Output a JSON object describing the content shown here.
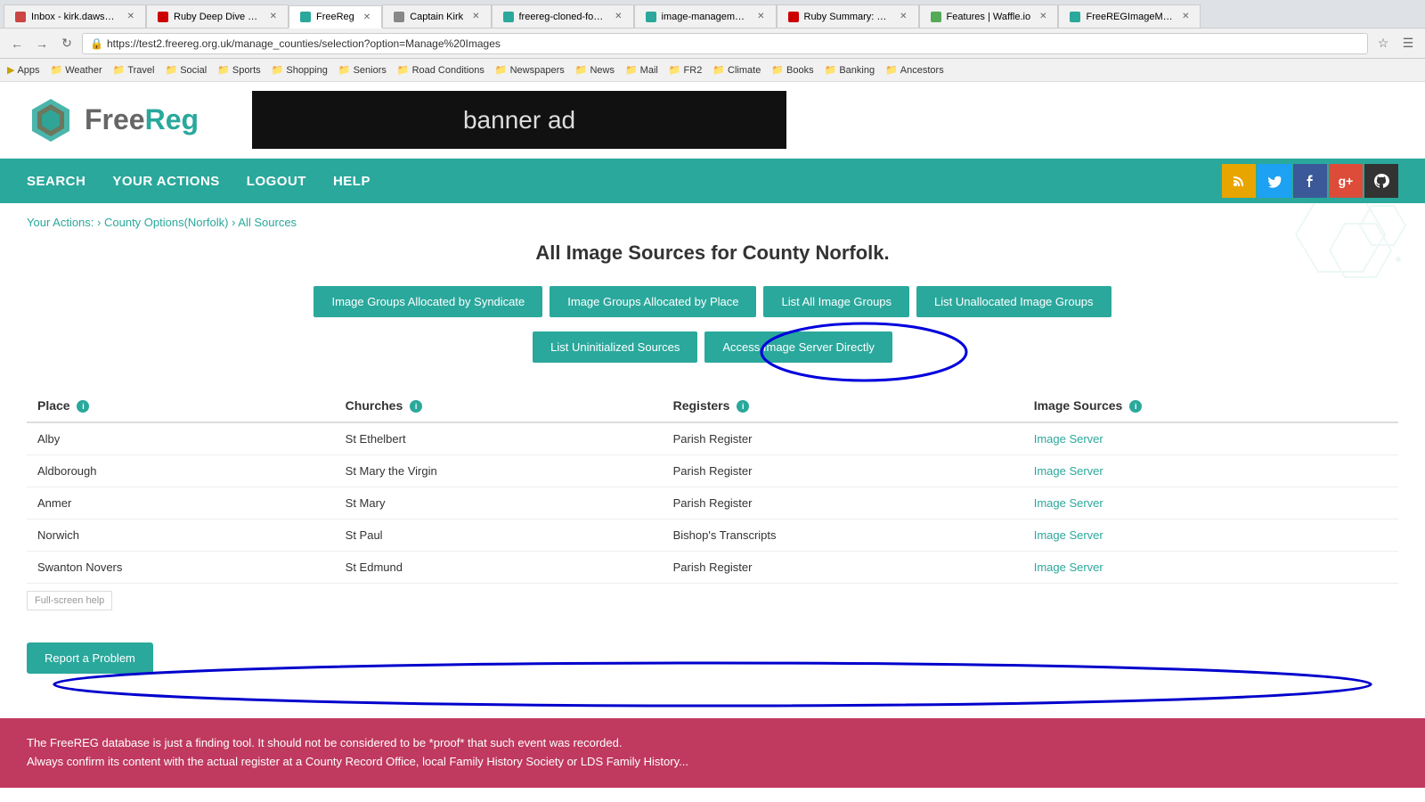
{
  "browser": {
    "tabs": [
      {
        "label": "Inbox - kirk.dawson.bo...",
        "favicon": "mail",
        "active": false
      },
      {
        "label": "Ruby Deep Dive - The...",
        "favicon": "ruby",
        "active": false
      },
      {
        "label": "FreeReg",
        "favicon": "freereg",
        "active": true
      },
      {
        "label": "Captain Kirk",
        "favicon": "default",
        "active": false
      },
      {
        "label": "freereg-cloned-for-kir...",
        "favicon": "default",
        "active": false
      },
      {
        "label": "image-management -...",
        "favicon": "default",
        "active": false
      },
      {
        "label": "Ruby Summary: Ruby...",
        "favicon": "ruby",
        "active": false
      },
      {
        "label": "Features | Waffle.io",
        "favicon": "default",
        "active": false
      },
      {
        "label": "FreeREGImageManage...",
        "favicon": "default",
        "active": false
      }
    ],
    "address": "https://test2.freereg.org.uk/manage_counties/selection?option=Manage%20Images"
  },
  "bookmarks": {
    "items": [
      {
        "label": "Apps",
        "type": "folder"
      },
      {
        "label": "Weather",
        "type": "folder"
      },
      {
        "label": "Travel",
        "type": "folder"
      },
      {
        "label": "Social",
        "type": "folder"
      },
      {
        "label": "Sports",
        "type": "folder"
      },
      {
        "label": "Shopping",
        "type": "folder"
      },
      {
        "label": "Seniors",
        "type": "folder"
      },
      {
        "label": "Road Conditions",
        "type": "folder"
      },
      {
        "label": "Newspapers",
        "type": "folder"
      },
      {
        "label": "News",
        "type": "folder"
      },
      {
        "label": "Mail",
        "type": "folder"
      },
      {
        "label": "FR2",
        "type": "folder"
      },
      {
        "label": "Climate",
        "type": "folder"
      },
      {
        "label": "Books",
        "type": "folder"
      },
      {
        "label": "Banking",
        "type": "folder"
      },
      {
        "label": "Ancestors",
        "type": "folder"
      }
    ]
  },
  "logo": {
    "free": "Free",
    "reg": "Reg"
  },
  "banner": {
    "text": "banner ad"
  },
  "nav": {
    "links": [
      "SEARCH",
      "YOUR ACTIONS",
      "LOGOUT",
      "HELP"
    ]
  },
  "breadcrumb": {
    "parts": [
      "Your Actions:",
      "County Options(Norfolk)",
      "All Sources"
    ],
    "separators": [
      " › ",
      " › "
    ]
  },
  "page": {
    "title": "All Image Sources for County Norfolk."
  },
  "action_buttons": {
    "row1": [
      "Image Groups Allocated by Syndicate",
      "Image Groups Allocated by Place",
      "List All Image Groups",
      "List Unallocated Image Groups"
    ],
    "row2": [
      "List Uninitialized Sources",
      "Access Image Server Directly"
    ]
  },
  "table": {
    "columns": [
      "Place",
      "Churches",
      "Registers",
      "Image Sources"
    ],
    "rows": [
      {
        "place": "Alby",
        "church": "St Ethelbert",
        "register": "Parish Register",
        "image_source": "Image Server"
      },
      {
        "place": "Aldborough",
        "church": "St Mary the Virgin",
        "register": "Parish Register",
        "image_source": "Image Server"
      },
      {
        "place": "Anmer",
        "church": "St Mary",
        "register": "Parish Register",
        "image_source": "Image Server",
        "highlighted": true
      },
      {
        "place": "Norwich",
        "church": "St Paul",
        "register": "Bishop's Transcripts",
        "image_source": "Image Server"
      },
      {
        "place": "Swanton Novers",
        "church": "St Edmund",
        "register": "Parish Register",
        "image_source": "Image Server"
      }
    ]
  },
  "buttons": {
    "report": "Report a Problem",
    "fullscreen_hint": "Full-screen help"
  },
  "footer": {
    "text1": "The FreeREG database is just a finding tool. It should not be considered to be *proof* that such event was recorded.",
    "text2": "Always confirm its content with the actual register at a County Record Office, local Family History Society or LDS Family History..."
  },
  "social_icons": {
    "rss": "RSS",
    "twitter": "Twitter",
    "facebook": "Facebook",
    "google": "Google+",
    "github": "GitHub"
  }
}
